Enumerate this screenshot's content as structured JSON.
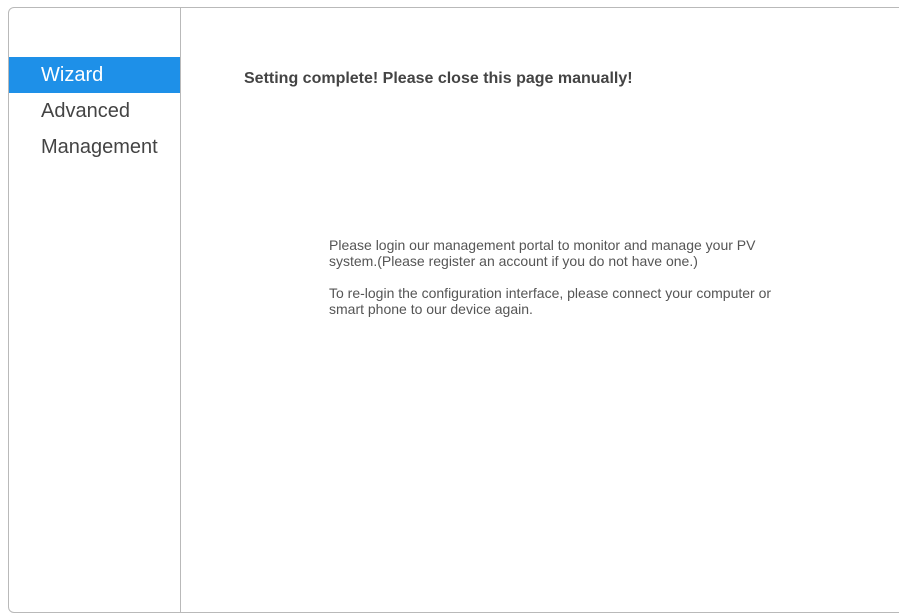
{
  "sidebar": {
    "items": [
      {
        "label": "Wizard",
        "active": true
      },
      {
        "label": "Advanced",
        "active": false
      },
      {
        "label": "Management",
        "active": false
      }
    ]
  },
  "main": {
    "title": "Setting complete! Please close this page manually!",
    "paragraphs": [
      "Please login our management portal to monitor and manage your PV system.(Please register an account if you do not have one.)",
      "To re-login the configuration interface, please connect your computer or smart phone to our device again."
    ]
  },
  "colors": {
    "accent": "#1e90e8",
    "border": "#b9b9b9",
    "text": "#444444"
  }
}
